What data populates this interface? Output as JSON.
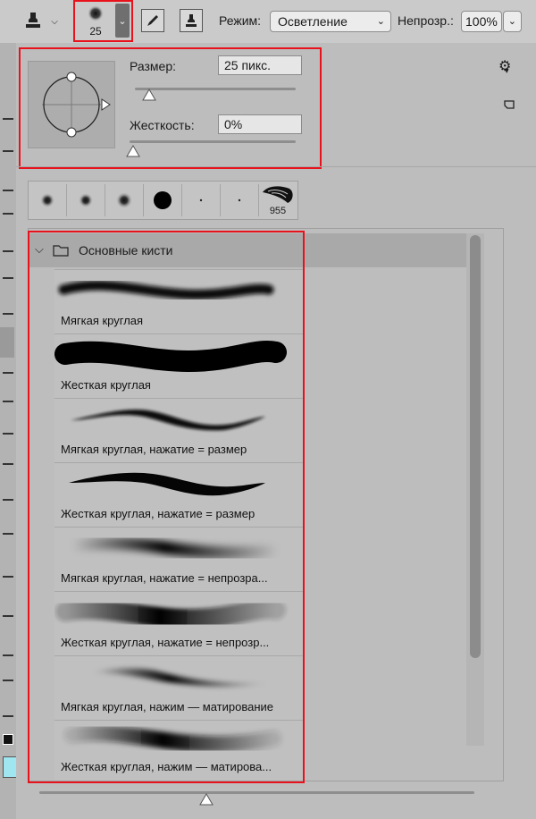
{
  "toolbar": {
    "tool_icon": "clone-stamp-icon",
    "brush_size_display": "25",
    "mode_label": "Режим:",
    "mode_value": "Осветление",
    "opacity_label": "Непрозр.:",
    "opacity_value": "100%"
  },
  "brush_settings": {
    "size_label": "Размер:",
    "size_value": "25 пикс.",
    "size_slider_fraction": 0.09,
    "hardness_label": "Жесткость:",
    "hardness_value": "0%",
    "hardness_slider_fraction": 0.0
  },
  "recent_tips": {
    "last_tip_count": "955"
  },
  "brush_group": {
    "name": "Основные кисти",
    "brushes": [
      {
        "label": "Мягкая круглая"
      },
      {
        "label": "Жесткая круглая"
      },
      {
        "label": "Мягкая круглая, нажатие = размер"
      },
      {
        "label": "Жесткая круглая, нажатие = размер"
      },
      {
        "label": "Мягкая круглая, нажатие = непрозра..."
      },
      {
        "label": "Жесткая круглая, нажатие = непрозр..."
      },
      {
        "label": "Мягкая круглая, нажим — матирование"
      },
      {
        "label": "Жесткая круглая, нажим — матирова..."
      }
    ]
  },
  "colors": {
    "highlight": "#e8121c",
    "panel": "#bdbdbd",
    "accent_swatch": "#9fe6f0"
  }
}
